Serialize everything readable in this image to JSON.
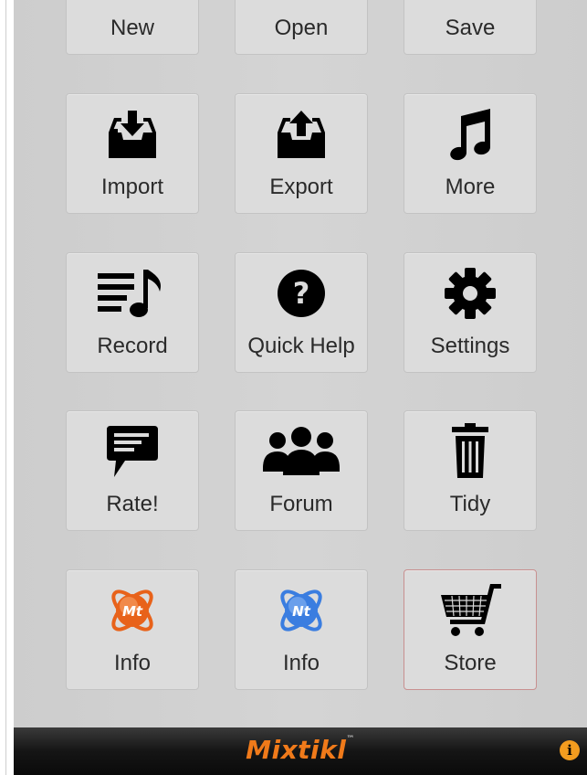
{
  "tiles": {
    "new": {
      "label": "New"
    },
    "open": {
      "label": "Open"
    },
    "save": {
      "label": "Save"
    },
    "import": {
      "label": "Import",
      "icon": "inbox-download-icon"
    },
    "export": {
      "label": "Export",
      "icon": "inbox-upload-icon"
    },
    "more": {
      "label": "More",
      "icon": "music-note-icon"
    },
    "record": {
      "label": "Record",
      "icon": "playlist-music-icon"
    },
    "quick_help": {
      "label": "Quick Help",
      "icon": "question-circle-icon"
    },
    "settings": {
      "label": "Settings",
      "icon": "gear-icon"
    },
    "rate": {
      "label": "Rate!",
      "icon": "speech-bubble-icon"
    },
    "forum": {
      "label": "Forum",
      "icon": "people-group-icon"
    },
    "tidy": {
      "label": "Tidy",
      "icon": "trash-icon"
    },
    "info_mt": {
      "label": "Info",
      "icon": "mixtikl-logo-icon",
      "badge": "Mt",
      "color": "#e8621a"
    },
    "info_nt": {
      "label": "Info",
      "icon": "noatikl-logo-icon",
      "badge": "Nt",
      "color": "#3a7de0"
    },
    "store": {
      "label": "Store",
      "icon": "shopping-cart-icon"
    }
  },
  "footer": {
    "brand": "Mixtikl",
    "info_glyph": "i",
    "brand_color": "#f07a1a"
  }
}
